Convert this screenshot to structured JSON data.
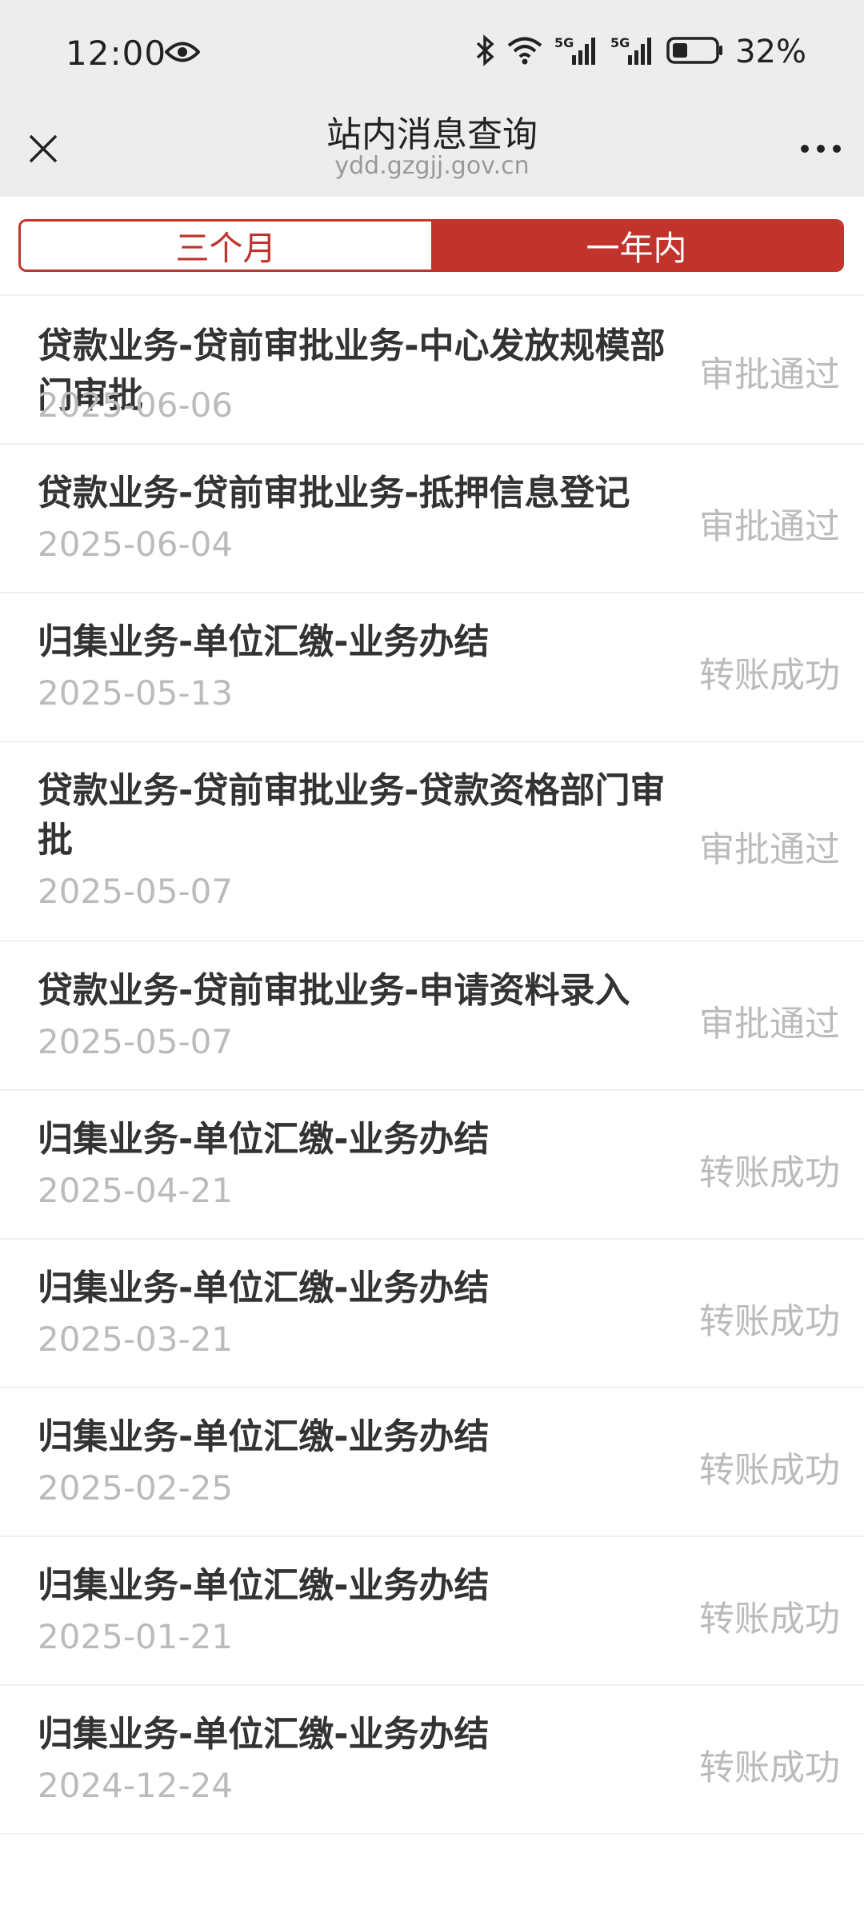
{
  "status_bar": {
    "time": "12:00",
    "battery": "32%",
    "icons": [
      "eye-icon",
      "bluetooth-icon",
      "wifi-icon",
      "signal-5g-icon",
      "signal-5g-icon",
      "battery-icon"
    ]
  },
  "nav": {
    "title": "站内消息查询",
    "url": "ydd.gzgjj.gov.cn",
    "close_icon": "close-icon",
    "more_icon": "more-icon"
  },
  "tabs": [
    {
      "label": "三个月",
      "active": false
    },
    {
      "label": "一年内",
      "active": true
    }
  ],
  "colors": {
    "accent": "#c0342c",
    "muted": "#bbbbbb"
  },
  "messages": [
    {
      "title": "贷款业务-贷前审批业务-中心发放规模部门审批",
      "date": "2025-06-06",
      "status": "审批通过"
    },
    {
      "title": "贷款业务-贷前审批业务-抵押信息登记",
      "date": "2025-06-04",
      "status": "审批通过"
    },
    {
      "title": "归集业务-单位汇缴-业务办结",
      "date": "2025-05-13",
      "status": "转账成功"
    },
    {
      "title": "贷款业务-贷前审批业务-贷款资格部门审批",
      "date": "2025-05-07",
      "status": "审批通过"
    },
    {
      "title": "贷款业务-贷前审批业务-申请资料录入",
      "date": "2025-05-07",
      "status": "审批通过"
    },
    {
      "title": "归集业务-单位汇缴-业务办结",
      "date": "2025-04-21",
      "status": "转账成功"
    },
    {
      "title": "归集业务-单位汇缴-业务办结",
      "date": "2025-03-21",
      "status": "转账成功"
    },
    {
      "title": "归集业务-单位汇缴-业务办结",
      "date": "2025-02-25",
      "status": "转账成功"
    },
    {
      "title": "归集业务-单位汇缴-业务办结",
      "date": "2025-01-21",
      "status": "转账成功"
    },
    {
      "title": "归集业务-单位汇缴-业务办结",
      "date": "2024-12-24",
      "status": "转账成功"
    }
  ]
}
